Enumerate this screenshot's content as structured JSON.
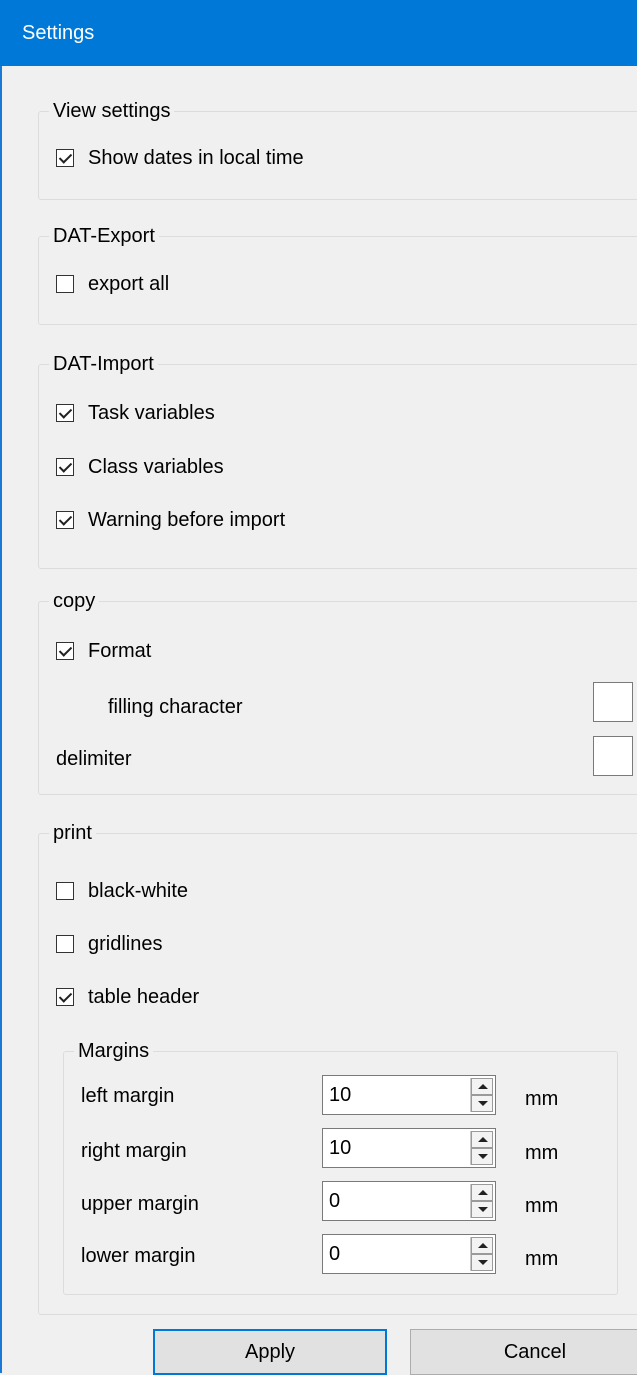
{
  "window": {
    "title": "Settings"
  },
  "view_settings": {
    "legend": "View settings",
    "show_dates_local": {
      "label": "Show dates in local time",
      "checked": true
    }
  },
  "dat_export": {
    "legend": "DAT-Export",
    "export_all": {
      "label": "export all",
      "checked": false
    }
  },
  "dat_import": {
    "legend": "DAT-Import",
    "task_variables": {
      "label": "Task variables",
      "checked": true
    },
    "class_variables": {
      "label": "Class variables",
      "checked": true
    },
    "warning_before_import": {
      "label": "Warning before import",
      "checked": true
    }
  },
  "copy": {
    "legend": "copy",
    "format": {
      "label": "Format",
      "checked": true
    },
    "filling_character": {
      "label": "filling character",
      "value": ""
    },
    "delimiter": {
      "label": "delimiter",
      "value": ""
    }
  },
  "print": {
    "legend": "print",
    "black_white": {
      "label": "black-white",
      "checked": false
    },
    "gridlines": {
      "label": "gridlines",
      "checked": false
    },
    "table_header": {
      "label": "table header",
      "checked": true
    },
    "margins": {
      "legend": "Margins",
      "unit": "mm",
      "left": {
        "label": "left margin",
        "value": "10"
      },
      "right": {
        "label": "right margin",
        "value": "10"
      },
      "upper": {
        "label": "upper margin",
        "value": "0"
      },
      "lower": {
        "label": "lower margin",
        "value": "0"
      }
    }
  },
  "buttons": {
    "apply": "Apply",
    "cancel": "Cancel"
  },
  "colors": {
    "titlebar": "#0078d7",
    "background": "#f0f0f0",
    "default_button_border": "#0078d7"
  }
}
